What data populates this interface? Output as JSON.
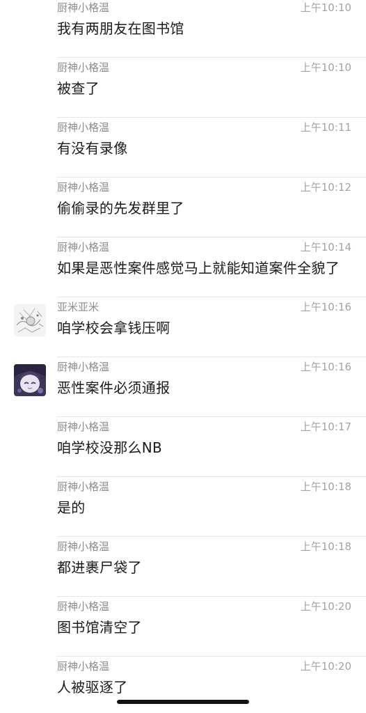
{
  "messages": [
    {
      "sender": "厨神小格温",
      "time": "上午10:10",
      "text": "我有两朋友在图书馆",
      "avatar": "none"
    },
    {
      "sender": "厨神小格温",
      "time": "上午10:10",
      "text": "被查了",
      "avatar": "none"
    },
    {
      "sender": "厨神小格温",
      "time": "上午10:11",
      "text": "有没有录像",
      "avatar": "none"
    },
    {
      "sender": "厨神小格温",
      "time": "上午10:12",
      "text": "偷偷录的先发群里了",
      "avatar": "none"
    },
    {
      "sender": "厨神小格温",
      "time": "上午10:14",
      "text": "如果是恶性案件感觉马上就能知道案件全貌了",
      "avatar": "none"
    },
    {
      "sender": "亚米亚米",
      "time": "上午10:16",
      "text": "咱学校会拿钱压啊",
      "avatar": "sketch-avatar"
    },
    {
      "sender": "厨神小格温",
      "time": "上午10:16",
      "text": "恶性案件必须通报",
      "avatar": "anime-avatar"
    },
    {
      "sender": "厨神小格温",
      "time": "上午10:17",
      "text": "咱学校没那么NB",
      "avatar": "none"
    },
    {
      "sender": "厨神小格温",
      "time": "上午10:18",
      "text": "是的",
      "avatar": "none"
    },
    {
      "sender": "厨神小格温",
      "time": "上午10:18",
      "text": "都进裹尸袋了",
      "avatar": "none"
    },
    {
      "sender": "厨神小格温",
      "time": "上午10:20",
      "text": "图书馆清空了",
      "avatar": "none"
    },
    {
      "sender": "厨神小格温",
      "time": "上午10:20",
      "text": "人被驱逐了",
      "avatar": "none"
    }
  ]
}
